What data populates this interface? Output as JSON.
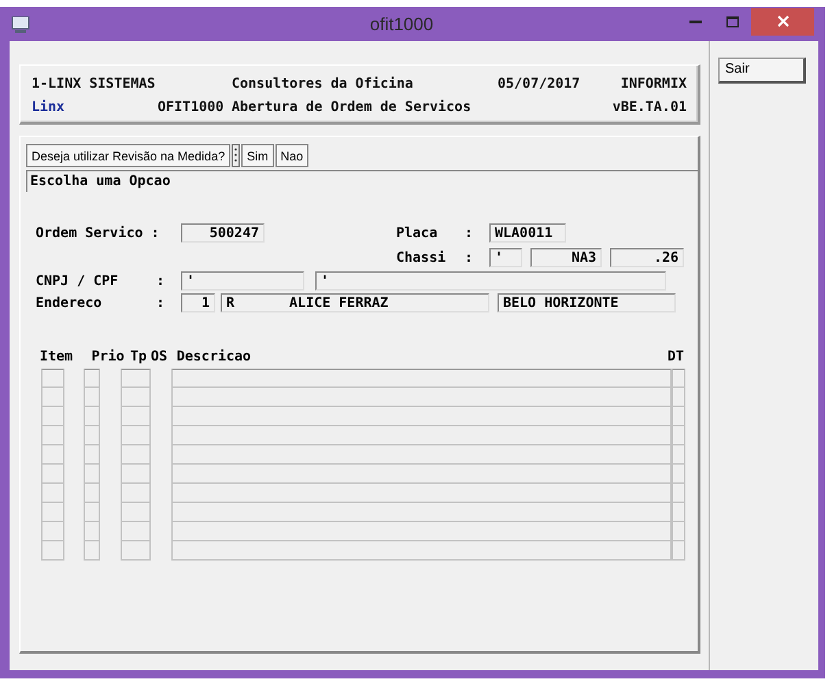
{
  "window": {
    "title": "ofit1000"
  },
  "header": {
    "line1": [
      "1-LINX SISTEMAS",
      "Consultores da Oficina",
      "05/07/2017",
      "INFORMIX"
    ],
    "line2": [
      "Linx",
      "OFIT1000",
      "Abertura de Ordem de Servicos",
      "vBE.TA.01"
    ]
  },
  "side_buttons": [
    "Sair"
  ],
  "prompt": {
    "question": "Deseja utilizar Revisão na Medida?",
    "buttons": [
      "Sim",
      "Nao"
    ]
  },
  "message": "Escolha uma Opcao",
  "form": {
    "ordem_servico": {
      "label": "Ordem Servico :",
      "value": "500247"
    },
    "placa": {
      "label": "Placa",
      "sep": ":",
      "value": "WLA0011"
    },
    "chassi": {
      "label": "Chassi",
      "sep": ":",
      "parts": [
        "'",
        "NA3",
        ".26"
      ]
    },
    "cnpj": {
      "label": "CNPJ / CPF",
      "sep": ":",
      "parts": [
        "'",
        "'"
      ]
    },
    "endereco": {
      "label": "Endereco",
      "sep": ":",
      "number": "1",
      "street": [
        "R",
        "ALICE FERRAZ"
      ],
      "city": "BELO HORIZONTE"
    }
  },
  "table": {
    "columns": [
      "Item",
      "Prio",
      "Tp",
      "OS",
      "Descricao",
      "DT"
    ]
  }
}
